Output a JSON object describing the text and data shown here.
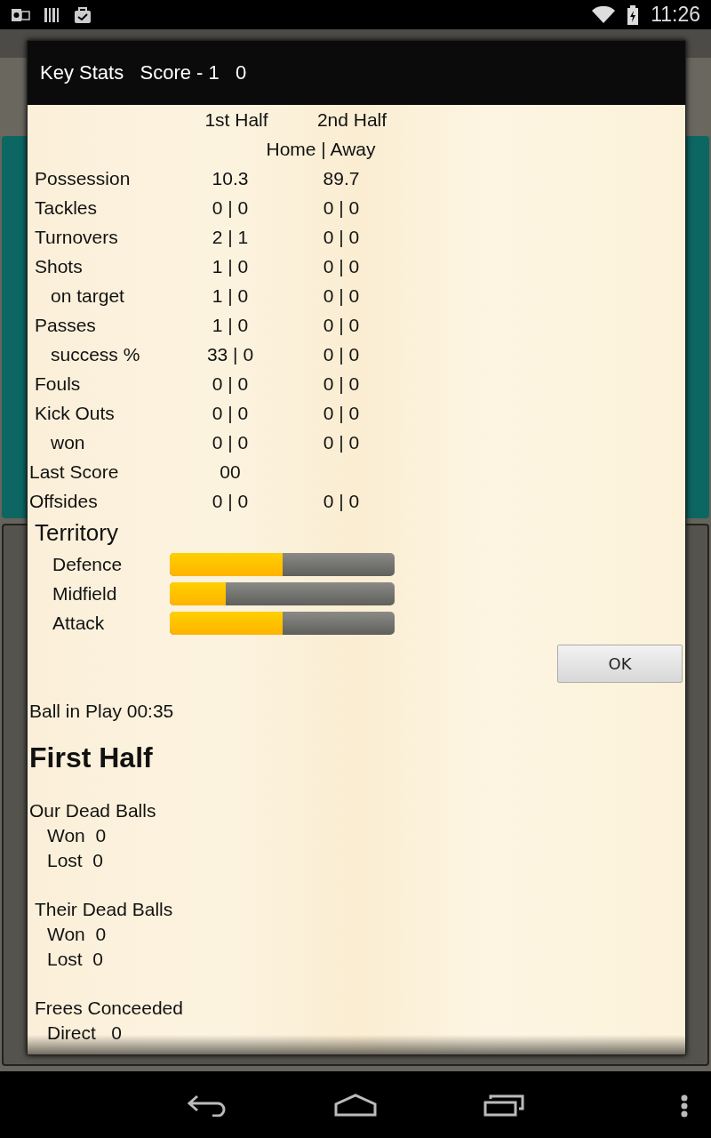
{
  "status_bar": {
    "time": "11:26"
  },
  "dialog": {
    "title": "Key Stats   Score - 1   0",
    "columns": [
      "1st Half",
      "2nd Half"
    ],
    "subheader": "Home | Away",
    "rows": [
      {
        "kind": "main",
        "label": "Possession",
        "first": "10.3",
        "second": "89.7"
      },
      {
        "kind": "main",
        "label": "Tackles",
        "first": "0 | 0",
        "second": "0 | 0"
      },
      {
        "kind": "main",
        "label": "Turnovers",
        "first": "2 | 1",
        "second": "0 | 0"
      },
      {
        "kind": "main",
        "label": "Shots",
        "first": "1 | 0",
        "second": "0 | 0"
      },
      {
        "kind": "sub",
        "label": "on target",
        "first": "1 | 0",
        "second": "0 | 0"
      },
      {
        "kind": "main",
        "label": "Passes",
        "first": "1 | 0",
        "second": "0 | 0"
      },
      {
        "kind": "sub",
        "label": "success %",
        "first": "33 | 0",
        "second": "0 | 0"
      },
      {
        "kind": "main",
        "label": "Fouls",
        "first": "0 | 0",
        "second": "0 | 0"
      },
      {
        "kind": "main",
        "label": "Kick Outs",
        "first": "0 | 0",
        "second": "0 | 0"
      },
      {
        "kind": "sub",
        "label": "won",
        "first": "0 | 0",
        "second": "0 | 0"
      },
      {
        "kind": "outdent",
        "label": "Last Score",
        "first": "00"
      },
      {
        "kind": "outdent",
        "label": "Offsides",
        "first": "0 | 0",
        "second": "0 | 0"
      }
    ],
    "territory": {
      "title": "Territory",
      "bars": [
        {
          "label": "Defence",
          "level": 0.5
        },
        {
          "label": "Midfield",
          "level": 0.25
        },
        {
          "label": "Attack",
          "level": 0.5
        }
      ]
    },
    "ok_button": "OK",
    "ball_in_play": "Ball in Play 00:35",
    "section_title": "First Half",
    "groups": [
      {
        "title": "Our Dead Balls",
        "kind": "flush",
        "items": [
          "Won  0",
          "Lost  0"
        ]
      },
      {
        "title": "Their Dead Balls",
        "kind": "indented",
        "items": [
          "Won  0",
          "Lost  0"
        ]
      },
      {
        "title": "Frees Conceeded",
        "kind": "indented",
        "items": [
          "Direct   0"
        ]
      }
    ]
  }
}
